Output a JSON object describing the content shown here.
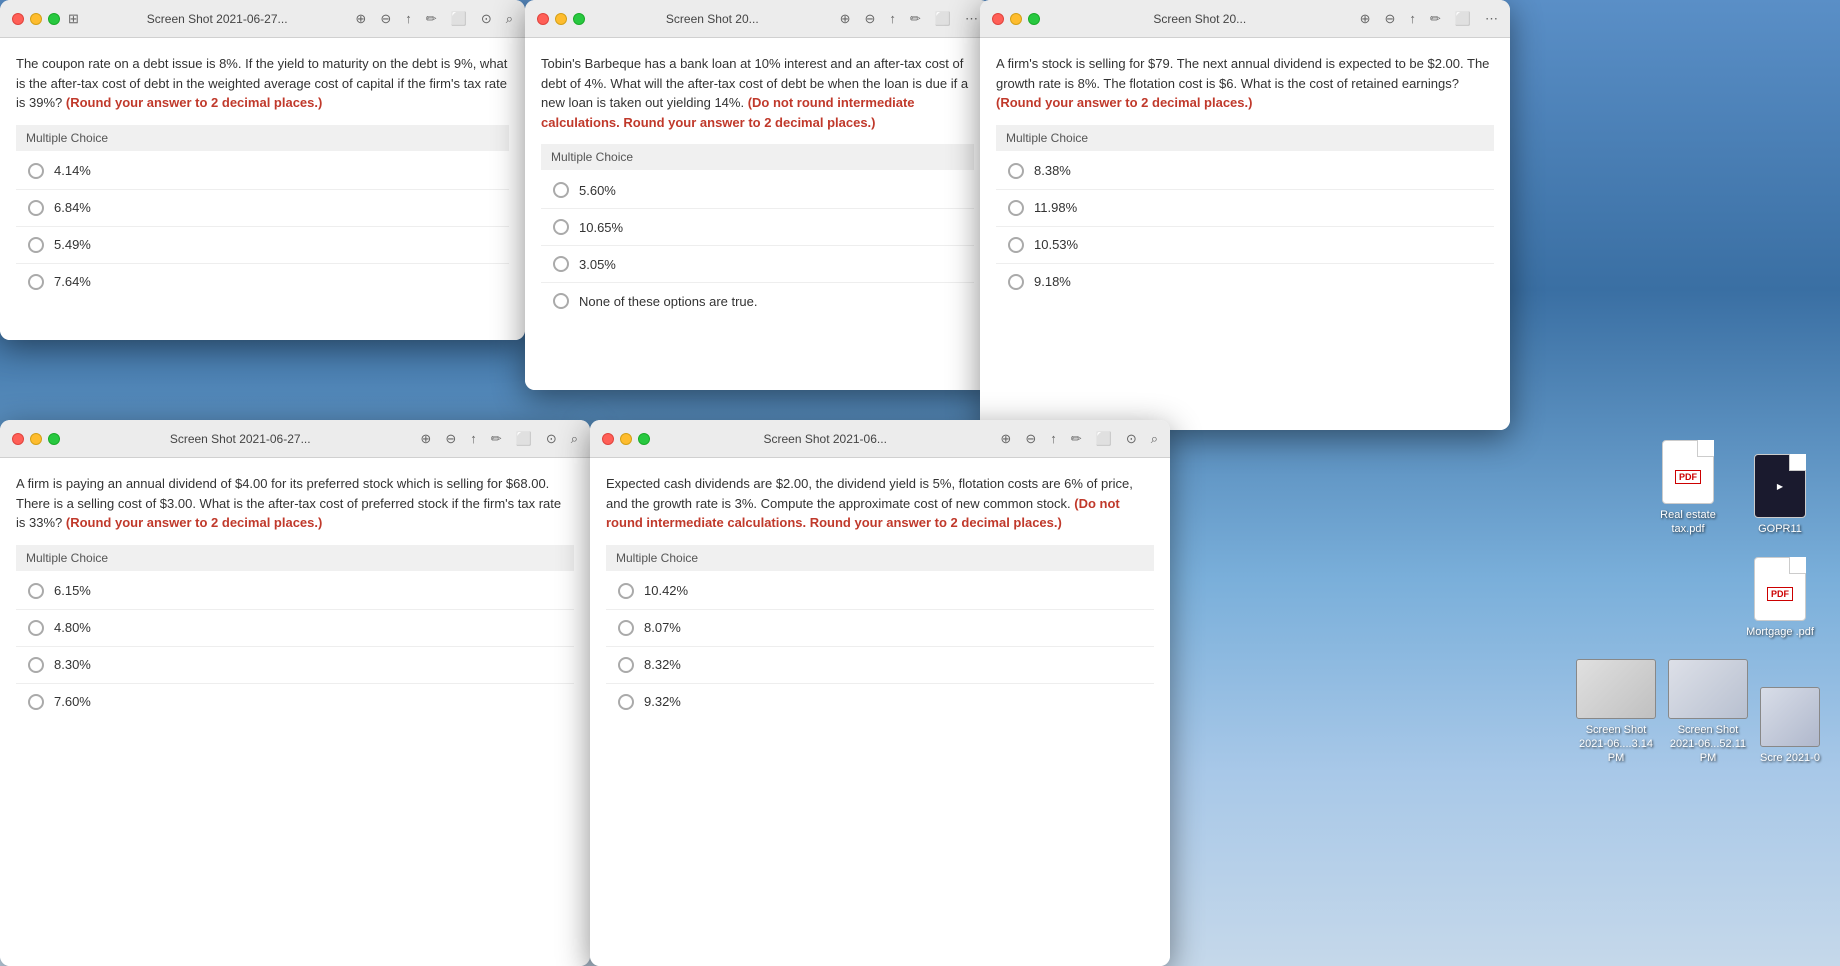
{
  "desktop": {
    "background": "sky"
  },
  "windows": {
    "window1": {
      "title": "Screen Shot 2021-06-27...",
      "question": "The coupon rate on a debt issue is 8%. If the yield to maturity on the debt is 9%, what is the after-tax cost of debt in the weighted average cost of capital if the firm's tax rate is 39%?",
      "question_emphasis": "(Round your answer to 2 decimal places.)",
      "mc_label": "Multiple Choice",
      "choices": [
        "4.14%",
        "6.84%",
        "5.49%",
        "7.64%"
      ]
    },
    "window2": {
      "title": "Screen Shot 20...",
      "question": "Tobin's Barbeque has a bank loan at 10% interest and an after-tax cost of debt of 4%. What will the after-tax cost of debt be when the loan is due if a new loan is taken out yielding 14%.",
      "question_emphasis": "(Do not round intermediate calculations. Round your answer to 2 decimal places.)",
      "mc_label": "Multiple Choice",
      "choices": [
        "5.60%",
        "10.65%",
        "3.05%",
        "None of these options are true."
      ]
    },
    "window3": {
      "title": "Screen Shot 20...",
      "question": "A firm's stock is selling for $79. The next annual dividend is expected to be $2.00. The growth rate is 8%. The flotation cost is $6. What is the cost of retained earnings?",
      "question_emphasis": "(Round your answer to 2 decimal places.)",
      "mc_label": "Multiple Choice",
      "choices": [
        "8.38%",
        "11.98%",
        "10.53%",
        "9.18%"
      ]
    },
    "window4": {
      "title": "Screen Shot 2021-06-27...",
      "question": "A firm is paying an annual dividend of $4.00 for its preferred stock which is selling for $68.00. There is a selling cost of $3.00. What is the after-tax cost of preferred stock if the firm's tax rate is 33%?",
      "question_emphasis": "(Round your answer to 2 decimal places.)",
      "mc_label": "Multiple Choice",
      "choices": [
        "6.15%",
        "4.80%",
        "8.30%",
        "7.60%"
      ]
    },
    "window5": {
      "title": "Screen Shot 2021-06...",
      "question": "Expected cash dividends are $2.00, the dividend yield is 5%, flotation costs are 6% of price, and the growth rate is 3%. Compute the approximate cost of new common stock.",
      "question_emphasis": "(Do not round intermediate calculations. Round your answer to 2 decimal places.)",
      "mc_label": "Multiple Choice",
      "choices": [
        "10.42%",
        "8.07%",
        "8.32%",
        "9.32%"
      ]
    }
  },
  "desktop_items": {
    "real_estate_label": "Real estate tax.pdf",
    "gopr_label": "GOPR11",
    "mortgage_label": "Mortgage .pdf",
    "screen_shot1_label": "Screen Shot 2021-06....3.14 PM",
    "screen_shot2_label": "Screen Shot 2021-06...52.11 PM",
    "screen_shot3_label": "Scre 2021-0",
    "screen_shot_icon_label": "Screen Shot"
  },
  "titlebar": {
    "zoom_in": "⊕",
    "zoom_out": "⊖",
    "share": "↑",
    "annotate": "✏",
    "resize": "⬜",
    "revert": "↩",
    "search": "⌕",
    "more": "⋯"
  }
}
